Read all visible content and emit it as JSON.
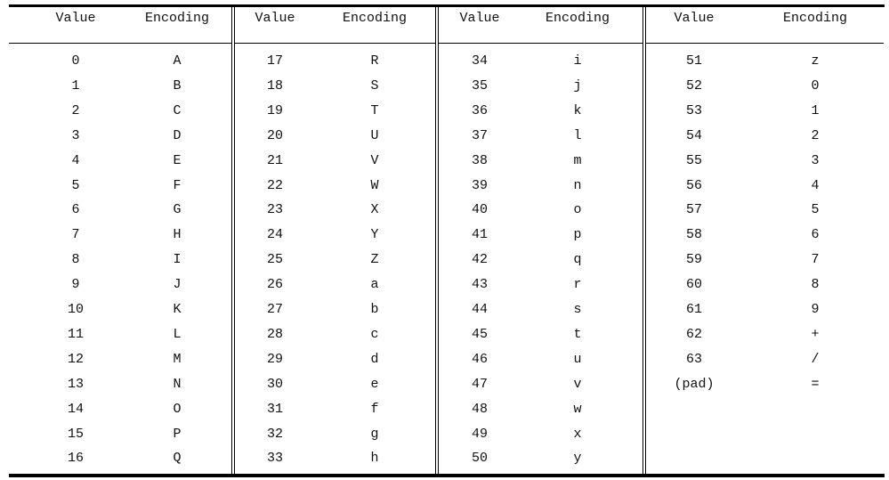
{
  "headers": {
    "value": "Value",
    "encoding": "Encoding"
  },
  "sections": [
    {
      "rows": [
        [
          "0",
          "A"
        ],
        [
          "1",
          "B"
        ],
        [
          "2",
          "C"
        ],
        [
          "3",
          "D"
        ],
        [
          "4",
          "E"
        ],
        [
          "5",
          "F"
        ],
        [
          "6",
          "G"
        ],
        [
          "7",
          "H"
        ],
        [
          "8",
          "I"
        ],
        [
          "9",
          "J"
        ],
        [
          "10",
          "K"
        ],
        [
          "11",
          "L"
        ],
        [
          "12",
          "M"
        ],
        [
          "13",
          "N"
        ],
        [
          "14",
          "O"
        ],
        [
          "15",
          "P"
        ],
        [
          "16",
          "Q"
        ]
      ]
    },
    {
      "rows": [
        [
          "17",
          "R"
        ],
        [
          "18",
          "S"
        ],
        [
          "19",
          "T"
        ],
        [
          "20",
          "U"
        ],
        [
          "21",
          "V"
        ],
        [
          "22",
          "W"
        ],
        [
          "23",
          "X"
        ],
        [
          "24",
          "Y"
        ],
        [
          "25",
          "Z"
        ],
        [
          "26",
          "a"
        ],
        [
          "27",
          "b"
        ],
        [
          "28",
          "c"
        ],
        [
          "29",
          "d"
        ],
        [
          "30",
          "e"
        ],
        [
          "31",
          "f"
        ],
        [
          "32",
          "g"
        ],
        [
          "33",
          "h"
        ]
      ]
    },
    {
      "rows": [
        [
          "34",
          "i"
        ],
        [
          "35",
          "j"
        ],
        [
          "36",
          "k"
        ],
        [
          "37",
          "l"
        ],
        [
          "38",
          "m"
        ],
        [
          "39",
          "n"
        ],
        [
          "40",
          "o"
        ],
        [
          "41",
          "p"
        ],
        [
          "42",
          "q"
        ],
        [
          "43",
          "r"
        ],
        [
          "44",
          "s"
        ],
        [
          "45",
          "t"
        ],
        [
          "46",
          "u"
        ],
        [
          "47",
          "v"
        ],
        [
          "48",
          "w"
        ],
        [
          "49",
          "x"
        ],
        [
          "50",
          "y"
        ]
      ]
    },
    {
      "rows": [
        [
          "51",
          "z"
        ],
        [
          "52",
          "0"
        ],
        [
          "53",
          "1"
        ],
        [
          "54",
          "2"
        ],
        [
          "55",
          "3"
        ],
        [
          "56",
          "4"
        ],
        [
          "57",
          "5"
        ],
        [
          "58",
          "6"
        ],
        [
          "59",
          "7"
        ],
        [
          "60",
          "8"
        ],
        [
          "61",
          "9"
        ],
        [
          "62",
          "+"
        ],
        [
          "63",
          "/"
        ],
        [
          "(pad)",
          "="
        ]
      ]
    }
  ]
}
